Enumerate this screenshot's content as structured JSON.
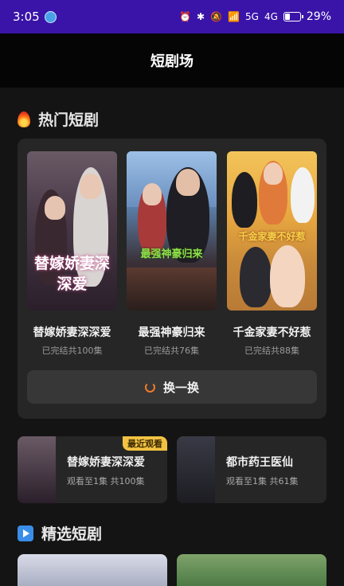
{
  "status_bar": {
    "time": "3:05",
    "network_1": "5G",
    "network_2": "4G",
    "battery": "29%",
    "battery_level": 0.29,
    "icons": [
      "alarm-icon",
      "bluetooth-icon",
      "mute-icon",
      "wifi-icon",
      "signal-icon",
      "battery-icon"
    ]
  },
  "header": {
    "title": "短剧场"
  },
  "hot_section": {
    "title": "热门短剧",
    "icon": "fire-icon",
    "dramas": [
      {
        "name": "替嫁娇妻深深爱",
        "meta": "已完结共100集",
        "poster_text": "替嫁娇妻深深爱"
      },
      {
        "name": "最强神豪归来",
        "meta": "已完结共76集",
        "poster_text": "最强神豪归来"
      },
      {
        "name": "千金家妻不好惹",
        "meta": "已完结共88集",
        "poster_text": "千金家妻不好惹"
      }
    ],
    "refresh_label": "换一换"
  },
  "history": [
    {
      "title": "替嫁娇妻深深爱",
      "progress": "观看至1集 共100集",
      "badge": "最近观看"
    },
    {
      "title": "都市药王医仙",
      "progress": "观看至1集 共61集"
    }
  ],
  "featured_section": {
    "title": "精选短剧",
    "icon": "play-icon"
  },
  "colors": {
    "status_bar": "#3a14a8",
    "background": "#141414",
    "card": "#262626",
    "accent_orange": "#f07a2a",
    "badge": "#f3c242"
  }
}
